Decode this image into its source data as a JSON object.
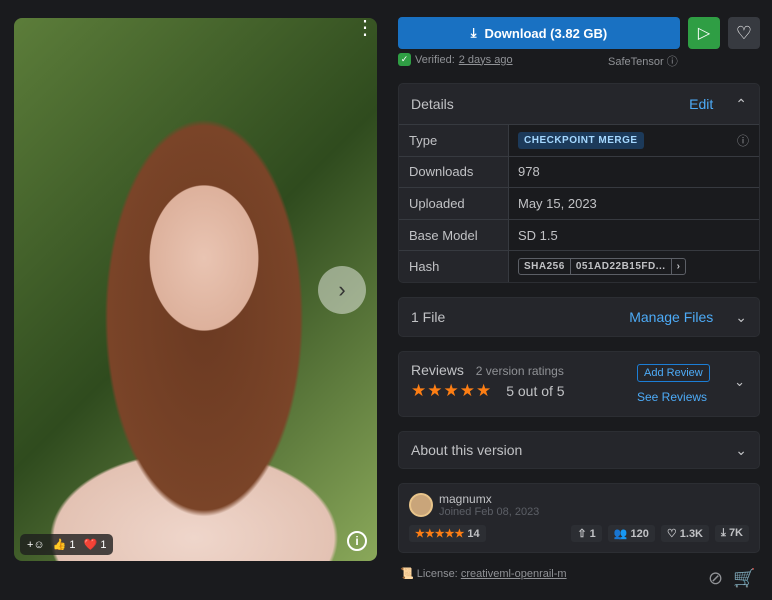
{
  "photo": {
    "reactions": {
      "like_count": "1",
      "heart_count": "1"
    }
  },
  "actions": {
    "download_label": "Download (3.82 GB)",
    "verified_label": "Verified:",
    "verified_time": "2 days ago",
    "safetensor": "SafeTensor"
  },
  "details": {
    "title": "Details",
    "edit": "Edit",
    "rows": [
      {
        "k": "Type",
        "v": "CHECKPOINT MERGE"
      },
      {
        "k": "Downloads",
        "v": "978"
      },
      {
        "k": "Uploaded",
        "v": "May 15, 2023"
      },
      {
        "k": "Base Model",
        "v": "SD 1.5"
      },
      {
        "k": "Hash",
        "algo": "SHA256",
        "v": "051AD22B15FD..."
      }
    ]
  },
  "files": {
    "title": "1 File",
    "manage": "Manage Files"
  },
  "reviews": {
    "title": "Reviews",
    "count": "2 version ratings",
    "add": "Add Review",
    "score": "5 out of 5",
    "see": "See Reviews",
    "rating": 5
  },
  "about": {
    "title": "About this version"
  },
  "creator": {
    "name": "magnumx",
    "joined": "Joined Feb 08, 2023",
    "rating_count": "14",
    "uploads": "1",
    "followers": "120",
    "likes": "1.3K",
    "downloads": "7K"
  },
  "license": {
    "label": "License:",
    "value": "creativeml-openrail-m"
  }
}
